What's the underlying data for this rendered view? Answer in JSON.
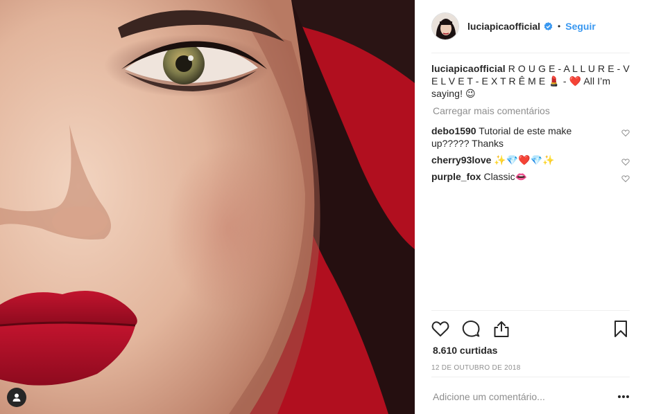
{
  "post": {
    "username": "luciapicaofficial",
    "follow_label": "Seguir",
    "separator": "•",
    "caption_user": "luciapicaofficial",
    "caption_text": " R O U G E - A L L U R E - V E L V E T - E X T R Ê M E 💄 - ❤️ All I’m saying! 😉",
    "load_more": "Carregar mais comentários",
    "comments": [
      {
        "user": "debo1590",
        "text": " Tutorial de este make up????? Thanks"
      },
      {
        "user": "cherry93love",
        "text": " ✨💎❤️💎✨"
      },
      {
        "user": "purple_fox",
        "text": " Classic👄"
      }
    ],
    "likes": "8.610 curtidas",
    "date": "12 DE OUTUBRO DE 2018",
    "add_comment_placeholder": "Adicione um comentário..."
  },
  "colors": {
    "accent": "#3897f0",
    "muted": "#8e8e8e",
    "text": "#262626",
    "photo_background": "#b0101e",
    "lips": "#b3102a"
  },
  "icons": {
    "verified": "verified-badge-icon",
    "like": "heart-outline-icon",
    "comment": "speech-bubble-icon",
    "share": "share-upload-icon",
    "save": "bookmark-icon",
    "options": "ellipsis-icon",
    "tag": "user-tag-icon"
  }
}
